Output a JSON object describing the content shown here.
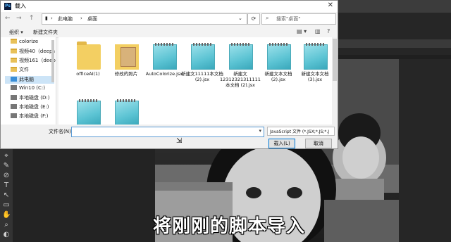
{
  "dialog": {
    "title": "载入",
    "title_icon": "Ps",
    "close_label": "✕",
    "nav": {
      "back": "←",
      "forward": "→",
      "up": "↑"
    },
    "breadcrumbs": [
      "此电脑",
      "桌面"
    ],
    "refresh_label": "⟳",
    "search_placeholder": "搜索\"桌面\"",
    "search_icon": "⌕",
    "toolbar": {
      "organize": "组织 ▾",
      "new_folder": "新建文件夹",
      "view_icon": "▤ ▾",
      "pane_icon": "▥",
      "help_icon": "?"
    },
    "sidebar": [
      {
        "label": "colorize",
        "icon": "folder-icon"
      },
      {
        "label": "视频40（deeps",
        "icon": "folder-icon"
      },
      {
        "label": "视频161（deep",
        "icon": "folder-icon"
      },
      {
        "label": "文件",
        "icon": "folder-icon"
      },
      {
        "label": "此电脑",
        "icon": "pc-icon"
      },
      {
        "label": "Win10 (C:)",
        "icon": "drive-icon"
      },
      {
        "label": "本地磁盘 (D:)",
        "icon": "drive-icon"
      },
      {
        "label": "本地磁盘 (E:)",
        "icon": "drive-icon"
      },
      {
        "label": "本地磁盘 (F:)",
        "icon": "drive-icon"
      }
    ],
    "files": [
      {
        "label": "officeAI(1)",
        "icon": "folder-icon"
      },
      {
        "label": "修改的照片",
        "icon": "image-folder-icon"
      },
      {
        "label": "AutoColorize.jsx",
        "icon": "jsx-file-icon"
      },
      {
        "label": "新建文11111本文档 (2).jsx",
        "icon": "jsx-file-icon"
      },
      {
        "label": "新建文12312321311111本文档 (2).jsx",
        "icon": "jsx-file-icon"
      },
      {
        "label": "新建文本文档 (2).jsx",
        "icon": "jsx-file-icon"
      },
      {
        "label": "新建文本文档 (3).jsx",
        "icon": "jsx-file-icon"
      },
      {
        "label": "",
        "icon": "jsx-file-icon"
      },
      {
        "label": "",
        "icon": "jsx-file-icon"
      }
    ],
    "filename_label": "文件名(N):",
    "filename_value": "",
    "dropdown_icon": "▾",
    "filetype": "JavaScript 文件 (*.JSX;*.JS;*.J",
    "load_button": "载入(L)",
    "cancel_button": "取消"
  },
  "ps_tools": [
    "✥",
    "⌖",
    "✎",
    "⊘",
    "T",
    "↖",
    "▭",
    "✋",
    "⌕",
    "◐"
  ],
  "subtitle": "将刚刚的脚本导入",
  "cursor_glyph": "⇲"
}
